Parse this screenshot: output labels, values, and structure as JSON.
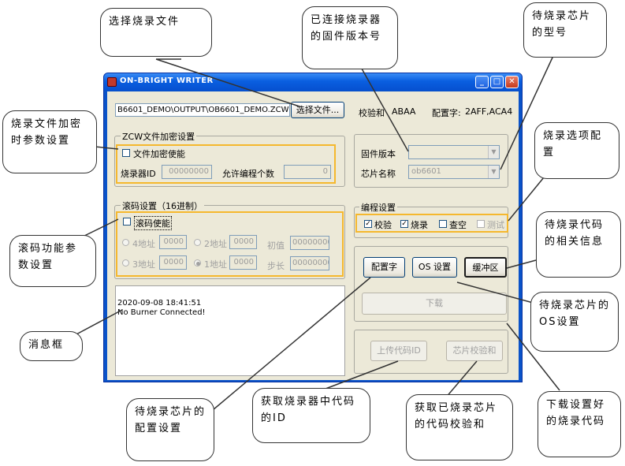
{
  "window": {
    "title": "ON-BRIGHT WRITER",
    "controls": [
      "_",
      "□",
      "✕"
    ]
  },
  "top": {
    "file_path": "B6601_DEMO\\OUTPUT\\OB6601_DEMO.ZCW",
    "select_file_button": "选择文件...",
    "checksum_label": "校验和",
    "checksum_value": "ABAA",
    "config_label": "配置字:",
    "config_value": "2AFF,ACA4"
  },
  "encrypt": {
    "legend": "ZCW文件加密设置",
    "enable_label": "文件加密使能",
    "burner_id_label": "烧录器ID",
    "burner_id_value": "00000000",
    "allow_count_label": "允许编程个数",
    "allow_count_value": "0"
  },
  "rolling": {
    "legend": "滚码设置（16进制）",
    "enable_label": "滚码使能",
    "addr4": "4地址",
    "addr4_value": "0000",
    "addr2": "2地址",
    "addr2_value": "0000",
    "init_label": "初值",
    "init_value": "00000000",
    "addr3": "3地址",
    "addr3_value": "0000",
    "addr1": "1地址",
    "addr1_value": "0000",
    "step_label": "步长",
    "step_value": "00000000"
  },
  "info": {
    "fw_label": "固件版本",
    "chip_label": "芯片名称",
    "chip_value": "ob6601"
  },
  "program": {
    "legend": "编程设置",
    "verify": "校验",
    "burn": "烧录",
    "blank_check": "查空",
    "test": "测试"
  },
  "buttons": {
    "config_word": "配置字",
    "os_setting": "OS 设置",
    "buffer": "缓冲区",
    "download": "下载",
    "upload_id": "上传代码ID",
    "chip_checksum": "芯片校验和"
  },
  "messages": {
    "time": "2020-09-08 18:41:51",
    "status": "No Burner Connected!"
  },
  "callouts": {
    "select_file": "选择烧录文件",
    "fw_version": "已连接烧录器的固件版本号",
    "chip_model": "待烧录芯片的型号",
    "encrypt": "烧录文件加密时参数设置",
    "burn_options": "烧录选项配置",
    "rolling": "滚码功能参数设置",
    "buffer_info": "待烧录代码的相关信息",
    "message_box": "消息框",
    "os_setting": "待烧录芯片的OS设置",
    "config_setting": "待烧录芯片的配置设置",
    "get_id": "获取烧录器中代码的ID",
    "get_checksum": "获取已烧录芯片的代码校验和",
    "download_code": "下载设置好的烧录代码"
  },
  "colors": {
    "titlebar": "#0a5fe0",
    "highlight": "#f5b82e",
    "dialog": "#ece9d8"
  }
}
